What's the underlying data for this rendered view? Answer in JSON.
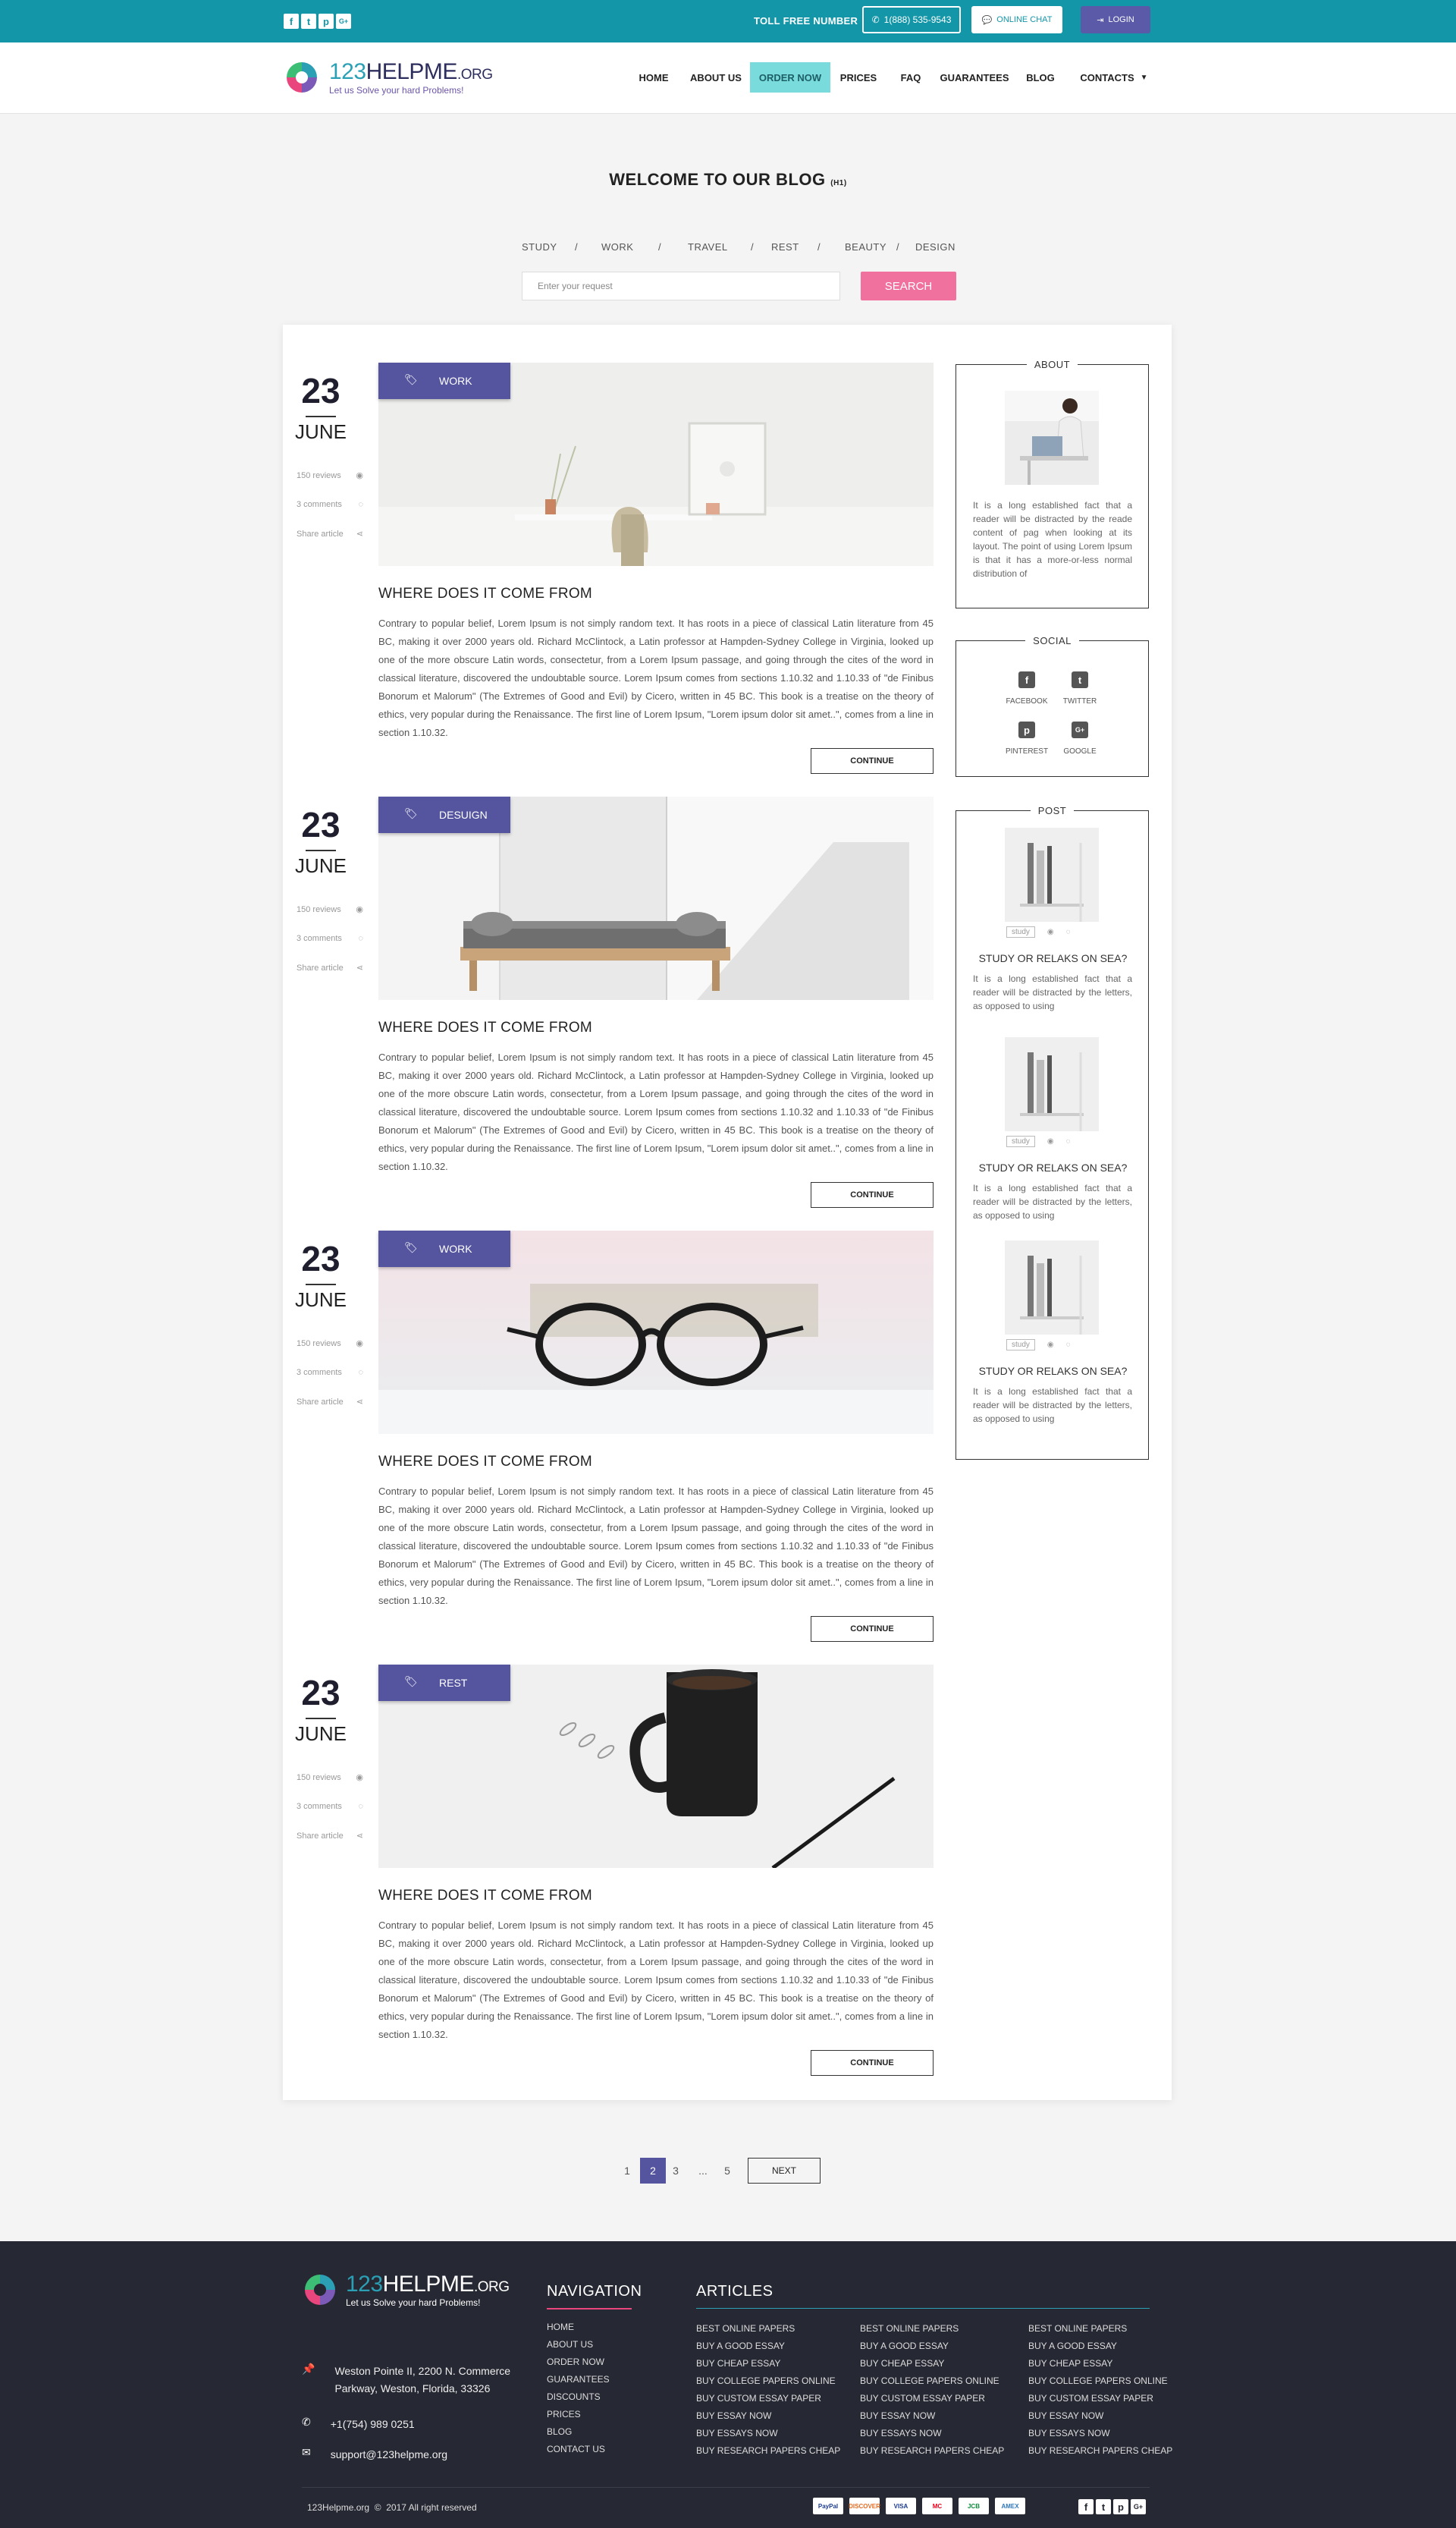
{
  "topbar": {
    "social": [
      "f",
      "t",
      "p",
      "G+"
    ],
    "toll_label": "TOLL FREE NUMBER",
    "phone": "1(888) 535-9543",
    "chat": "ONLINE CHAT",
    "login": "LOGIN"
  },
  "logo": {
    "num": "123",
    "name": "HELPME",
    "suffix": ".ORG",
    "tagline": "Let us Solve your hard Problems!"
  },
  "nav": [
    {
      "label": "HOME"
    },
    {
      "label": "ABOUT US"
    },
    {
      "label": "ORDER NOW"
    },
    {
      "label": "PRICES"
    },
    {
      "label": "FAQ"
    },
    {
      "label": "GUARANTEES"
    },
    {
      "label": "BLOG"
    },
    {
      "label": "CONTACTS"
    }
  ],
  "page": {
    "title": "WELCOME TO OUR BLOG",
    "title_tag": "(H1)"
  },
  "categories": [
    "STUDY",
    "WORK",
    "TRAVEL",
    "REST",
    "BEAUTY",
    "DESIGN"
  ],
  "search": {
    "placeholder": "Enter your request",
    "button": "SEARCH"
  },
  "posts": [
    {
      "day": "23",
      "month": "JUNE",
      "tag": "WORK",
      "reviews": "150 reviews",
      "comments": "3 comments",
      "share": "Share article",
      "title": "WHERE DOES IT COME FROM",
      "body": "Contrary to popular belief, Lorem Ipsum is not simply random text. It has roots in a piece of classical Latin literature from 45 BC, making it over 2000 years old. Richard McClintock, a Latin professor at Hampden-Sydney College in Virginia, looked up one of the more obscure Latin words, consectetur, from a Lorem Ipsum passage, and going through the cites of the word in classical literature, discovered the undoubtable source. Lorem Ipsum comes from sections 1.10.32 and 1.10.33 of \"de Finibus Bonorum et Malorum\" (The Extremes of Good and Evil) by Cicero, written in 45 BC. This book is a treatise on the theory of ethics, very popular during the Renaissance. The first line of Lorem Ipsum, \"Lorem ipsum dolor sit amet..\", comes from a line in section 1.10.32.",
      "button": "CONTINUE"
    },
    {
      "day": "23",
      "month": "JUNE",
      "tag": "DESUIGN",
      "reviews": "150 reviews",
      "comments": "3 comments",
      "share": "Share article",
      "title": "WHERE DOES IT COME FROM",
      "body": "Contrary to popular belief, Lorem Ipsum is not simply random text. It has roots in a piece of classical Latin literature from 45 BC, making it over 2000 years old. Richard McClintock, a Latin professor at Hampden-Sydney College in Virginia, looked up one of the more obscure Latin words, consectetur, from a Lorem Ipsum passage, and going through the cites of the word in classical literature, discovered the undoubtable source. Lorem Ipsum comes from sections 1.10.32 and 1.10.33 of \"de Finibus Bonorum et Malorum\" (The Extremes of Good and Evil) by Cicero, written in 45 BC. This book is a treatise on the theory of ethics, very popular during the Renaissance. The first line of Lorem Ipsum, \"Lorem ipsum dolor sit amet..\", comes from a line in section 1.10.32.",
      "button": "CONTINUE"
    },
    {
      "day": "23",
      "month": "JUNE",
      "tag": "WORK",
      "reviews": "150 reviews",
      "comments": "3 comments",
      "share": "Share article",
      "title": "WHERE DOES IT COME FROM",
      "body": "Contrary to popular belief, Lorem Ipsum is not simply random text. It has roots in a piece of classical Latin literature from 45 BC, making it over 2000 years old. Richard McClintock, a Latin professor at Hampden-Sydney College in Virginia, looked up one of the more obscure Latin words, consectetur, from a Lorem Ipsum passage, and going through the cites of the word in classical literature, discovered the undoubtable source. Lorem Ipsum comes from sections 1.10.32 and 1.10.33 of \"de Finibus Bonorum et Malorum\" (The Extremes of Good and Evil) by Cicero, written in 45 BC. This book is a treatise on the theory of ethics, very popular during the Renaissance. The first line of Lorem Ipsum, \"Lorem ipsum dolor sit amet..\", comes from a line in section 1.10.32.",
      "button": "CONTINUE"
    },
    {
      "day": "23",
      "month": "JUNE",
      "tag": "REST",
      "reviews": "150 reviews",
      "comments": "3 comments",
      "share": "Share article",
      "title": "WHERE DOES IT COME FROM",
      "body": "Contrary to popular belief, Lorem Ipsum is not simply random text. It has roots in a piece of classical Latin literature from 45 BC, making it over 2000 years old. Richard McClintock, a Latin professor at Hampden-Sydney College in Virginia, looked up one of the more obscure Latin words, consectetur, from a Lorem Ipsum passage, and going through the cites of the word in classical literature, discovered the undoubtable source. Lorem Ipsum comes from sections 1.10.32 and 1.10.33 of \"de Finibus Bonorum et Malorum\" (The Extremes of Good and Evil) by Cicero, written in 45 BC. This book is a treatise on the theory of ethics, very popular during the Renaissance. The first line of Lorem Ipsum, \"Lorem ipsum dolor sit amet..\", comes from a line in section 1.10.32.",
      "button": "CONTINUE"
    }
  ],
  "sidebar": {
    "about": {
      "title": "ABOUT",
      "text": "It is a long established fact that a reader will be distracted by the reade content of pag when looking at its layout. The point of using Lorem Ipsum is that it has a more-or-less normal distribution of"
    },
    "social": {
      "title": "SOCIAL",
      "items": [
        {
          "icon": "f",
          "label": "FACEBOOK"
        },
        {
          "icon": "t",
          "label": "TWITTER"
        },
        {
          "icon": "p",
          "label": "PINTEREST"
        },
        {
          "icon": "G+",
          "label": "GOOGLE"
        }
      ]
    },
    "post": {
      "title": "POST",
      "items": [
        {
          "tag": "study",
          "title": "STUDY OR RELAKS ON SEA?",
          "text": "It is a long established fact that a reader will be distracted by the letters, as opposed to using"
        },
        {
          "tag": "study",
          "title": "STUDY OR RELAKS ON SEA?",
          "text": "It is a long established fact that a reader will be distracted by the letters, as opposed to using"
        },
        {
          "tag": "study",
          "title": "STUDY OR RELAKS ON SEA?",
          "text": "It is a long established fact that a reader will be distracted by the letters, as opposed to using"
        }
      ]
    }
  },
  "pagination": {
    "pages": [
      "1",
      "2",
      "3",
      "...",
      "5"
    ],
    "next": "NEXT",
    "current": "2"
  },
  "footer": {
    "address": "Weston Pointe II, 2200 N. Commerce Parkway, Weston, Florida, 33326",
    "phone": "+1(754) 989 0251",
    "email": "support@123helpme.org",
    "nav_title": "NAVIGATION",
    "nav": [
      "HOME",
      "ABOUT US",
      "ORDER NOW",
      "GUARANTEES",
      "DISCOUNTS",
      "PRICES",
      "BLOG",
      "CONTACT US"
    ],
    "articles_title": "ARTICLES",
    "articles": [
      [
        "BEST ONLINE PAPERS",
        "BUY A GOOD ESSAY",
        "BUY CHEAP ESSAY",
        "BUY COLLEGE PAPERS ONLINE",
        "BUY CUSTOM ESSAY PAPER",
        "BUY ESSAY NOW",
        "BUY ESSAYS NOW",
        "BUY RESEARCH PAPERS CHEAP"
      ],
      [
        "BEST ONLINE PAPERS",
        "BUY A GOOD ESSAY",
        "BUY CHEAP ESSAY",
        "BUY COLLEGE PAPERS ONLINE",
        "BUY CUSTOM ESSAY PAPER",
        "BUY ESSAY NOW",
        "BUY ESSAYS NOW",
        "BUY RESEARCH PAPERS CHEAP"
      ],
      [
        "BEST ONLINE PAPERS",
        "BUY A GOOD ESSAY",
        "BUY CHEAP ESSAY",
        "BUY COLLEGE PAPERS ONLINE",
        "BUY CUSTOM ESSAY PAPER",
        "BUY ESSAY NOW",
        "BUY ESSAYS NOW",
        "BUY RESEARCH PAPERS CHEAP"
      ]
    ],
    "copyright": "123Helpme.org  ©  2017 All right reserved",
    "payments": [
      "PayPal",
      "DISCOVER",
      "VISA",
      "MC",
      "JCB",
      "AMEX"
    ],
    "social": [
      "f",
      "t",
      "p",
      "G+"
    ]
  },
  "colors": {
    "teal": "#1396a8",
    "purple": "#55559f",
    "pink": "#f0719e",
    "footer_bg": "#262833"
  }
}
